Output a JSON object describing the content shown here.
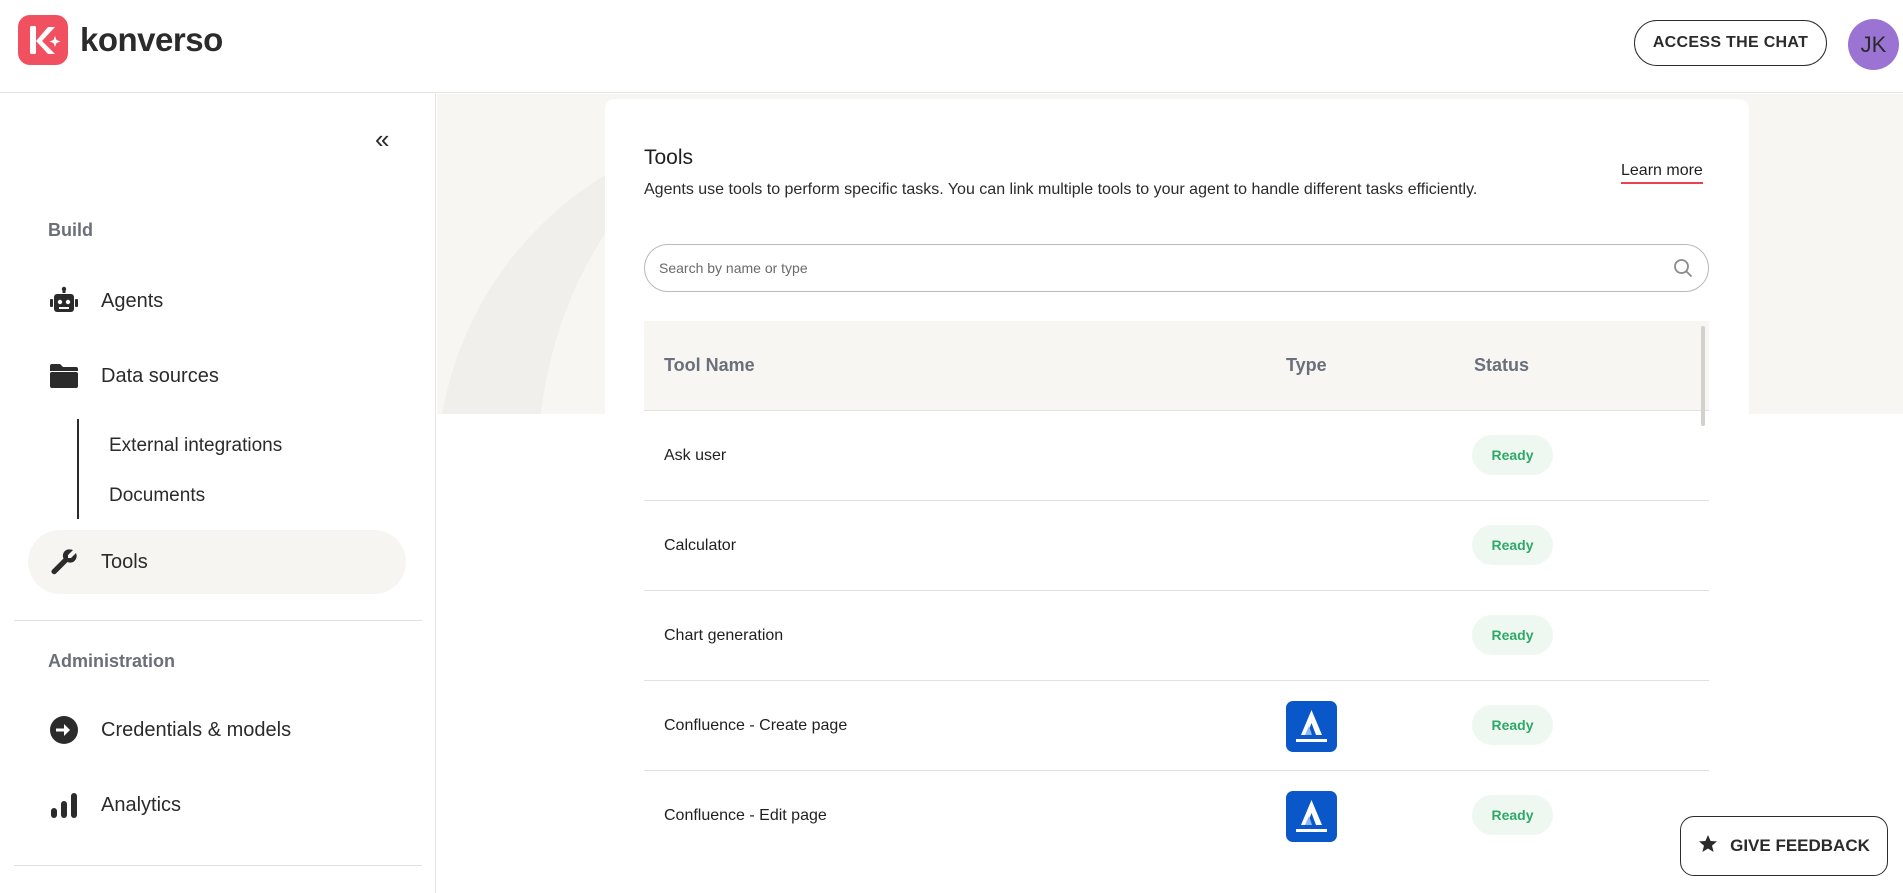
{
  "header": {
    "brand": "konverso",
    "access_chat_label": "ACCESS THE CHAT",
    "avatar_initials": "JK",
    "brand_color": "#f0505f",
    "avatar_color": "#9b74d3"
  },
  "sidebar": {
    "collapse_glyph": "«",
    "build_title": "Build",
    "items": [
      {
        "label": "Agents",
        "icon": "robot-icon"
      },
      {
        "label": "Data sources",
        "icon": "folder-icon"
      },
      {
        "label": "Tools",
        "icon": "wrench-icon",
        "active": true
      }
    ],
    "sub_items": [
      {
        "label": "External integrations"
      },
      {
        "label": "Documents"
      }
    ],
    "admin_title": "Administration",
    "admin_items": [
      {
        "label": "Credentials & models",
        "icon": "arrow-circle-icon"
      },
      {
        "label": "Analytics",
        "icon": "bar-chart-icon"
      }
    ]
  },
  "main": {
    "title": "Tools",
    "description": "Agents use tools to perform specific tasks. You can link multiple tools to your agent to handle different tasks efficiently.",
    "learn_more": "Learn more",
    "search": {
      "placeholder": "Search by name or type",
      "value": ""
    },
    "table": {
      "columns": [
        "Tool Name",
        "Type",
        "Status"
      ],
      "rows": [
        {
          "name": "Ask user",
          "type": "",
          "status": "Ready"
        },
        {
          "name": "Calculator",
          "type": "",
          "status": "Ready"
        },
        {
          "name": "Chart generation",
          "type": "",
          "status": "Ready"
        },
        {
          "name": "Confluence - Create page",
          "type": "atlassian-icon",
          "status": "Ready"
        },
        {
          "name": "Confluence - Edit page",
          "type": "atlassian-icon",
          "status": "Ready"
        }
      ]
    }
  },
  "feedback": {
    "label": "GIVE FEEDBACK",
    "icon": "star-icon"
  },
  "colors": {
    "status_ready_text": "#2fa868",
    "status_ready_bg": "#eef8f1",
    "atlassian_blue": "#0a57c9",
    "learn_more_underline": "#e8414f"
  }
}
